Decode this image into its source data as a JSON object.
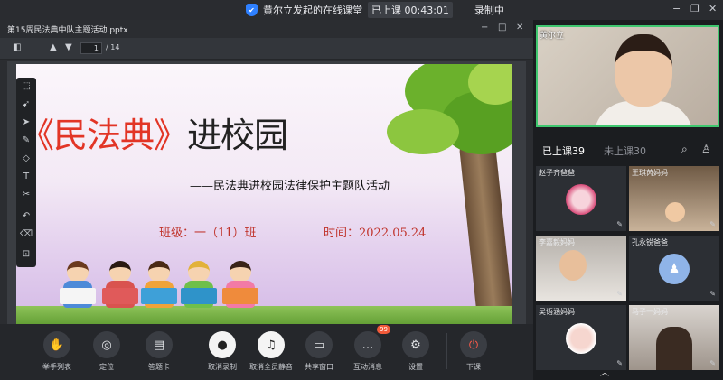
{
  "titlebar": {
    "session_title": "黄尔立发起的在线课堂",
    "status": "已上课",
    "timer": "00:43:01",
    "recording": "录制中",
    "icons": [
      "shield-icon",
      "minimize-icon",
      "restore-icon",
      "close-icon"
    ]
  },
  "document": {
    "filename": "第15周民法典中队主题活动.pptx",
    "current_page": "1",
    "total_pages": "/ 14",
    "sidebar_toggle": "◧",
    "page_controls": {
      "up": "▲",
      "down": "▼"
    },
    "window_controls": {
      "minimize": "−",
      "maximize": "□",
      "close": "✕"
    }
  },
  "slide": {
    "title_red_open": "《民法典》",
    "title_black": "进校园",
    "subtitle": "——民法典进校园法律保护主题队活动",
    "class_label": "班级：一（11）班",
    "time_label": "时间：2022.05.24"
  },
  "tools": [
    "select-icon",
    "laser-icon",
    "pointer-icon",
    "pen-icon",
    "shape-icon",
    "text-icon",
    "scissors-icon",
    "undo-icon",
    "eraser-icon",
    "clear-icon"
  ],
  "controls": [
    {
      "key": "hands",
      "label": "举手列表",
      "icon": "✋"
    },
    {
      "key": "location",
      "label": "定位",
      "icon": "◎"
    },
    {
      "key": "roster",
      "label": "答题卡",
      "icon": "▤"
    },
    {
      "key": "stop_rec",
      "label": "取消录制",
      "icon": "●"
    },
    {
      "key": "mute_all",
      "label": "取消全员静音",
      "icon": "♫"
    },
    {
      "key": "share",
      "label": "共享窗口",
      "icon": "▭"
    },
    {
      "key": "chat",
      "label": "互动消息",
      "icon": "…",
      "badge": "99"
    },
    {
      "key": "settings",
      "label": "设置",
      "icon": "⚙"
    },
    {
      "key": "end",
      "label": "下课",
      "icon": "⏻"
    }
  ],
  "teacher": {
    "name": "黄尔立"
  },
  "tabs": {
    "attended": "已上课39",
    "absent": "未上课30"
  },
  "students": [
    {
      "name": "赵子齐爸爸"
    },
    {
      "name": "王琪芮妈妈"
    },
    {
      "name": "李嘉毅妈妈"
    },
    {
      "name": "孔永锐爸爸"
    },
    {
      "name": "吴语涵妈妈"
    },
    {
      "name": "马子一妈妈"
    }
  ],
  "colors": {
    "accent": "#2e80ff",
    "speaker_border": "#3fc76f",
    "badge": "#f25a3a",
    "title_red": "#e23526"
  }
}
